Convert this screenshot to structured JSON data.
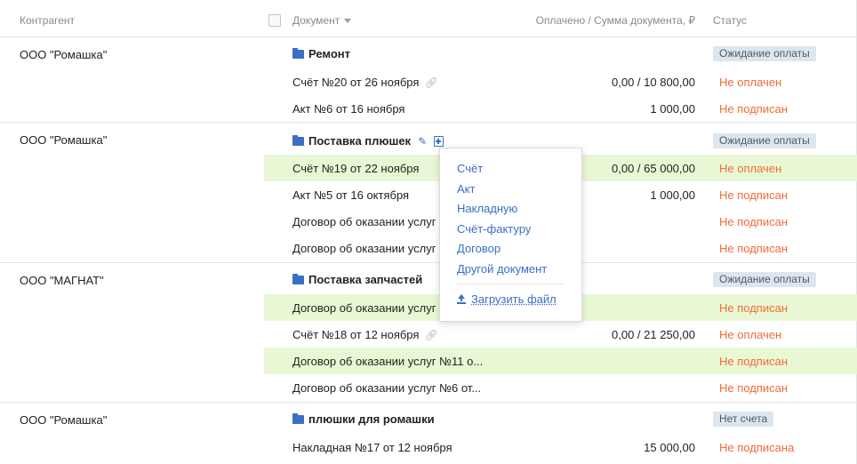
{
  "header": {
    "contractor": "Контрагент",
    "document": "Документ",
    "paid": "Оплачено / Сумма документа, ₽",
    "status": "Статус"
  },
  "groups": [
    {
      "contractor": "ООО \"Ромашка\"",
      "title": "Ремонт",
      "badge": "Ожидание оплаты",
      "rows": [
        {
          "doc": "Счёт №20 от 26 ноября",
          "amount": "0,00 / 10 800,00",
          "status": "Не оплачен"
        },
        {
          "doc": "Акт №6 от 16 ноября",
          "amount": "1 000,00",
          "status": "Не подписан"
        }
      ]
    },
    {
      "contractor": "ООО \"Ромашка\"",
      "title": "Поставка плюшек",
      "badge": "Ожидание оплаты",
      "rows": [
        {
          "doc": "Счёт №19 от 22 ноября",
          "amount": "0,00 / 65 000,00",
          "status": "Не оплачен"
        },
        {
          "doc": "Акт №5 от 16 октября",
          "amount": "1 000,00",
          "status": "Не подписан"
        },
        {
          "doc": "Договор об оказании услуг",
          "amount": "",
          "status": "Не подписан"
        },
        {
          "doc": "Договор об оказании услуг",
          "amount": "",
          "status": "Не подписан"
        }
      ]
    },
    {
      "contractor": "ООО \"МАГНАТ\"",
      "title": "Поставка запчастей",
      "badge": "Ожидание оплаты",
      "rows": [
        {
          "doc": "Договор об оказании услуг",
          "amount": "",
          "status": "Не подписан"
        },
        {
          "doc": "Счёт №18 от 12 ноября",
          "amount": "0,00 / 21 250,00",
          "status": "Не оплачен"
        },
        {
          "doc": "Договор об оказании услуг №11 о...",
          "amount": "",
          "status": "Не подписан"
        },
        {
          "doc": "Договор об оказании услуг №6 от...",
          "amount": "",
          "status": "Не подписан"
        }
      ]
    },
    {
      "contractor": "ООО \"Ромашка\"",
      "title": "плюшки для ромашки",
      "badge": "Нет счета",
      "rows": [
        {
          "doc": "Накладная №17 от 12 ноября",
          "amount": "15 000,00",
          "status": "Не подписана"
        }
      ]
    }
  ],
  "menu": {
    "items": [
      "Счёт",
      "Акт",
      "Накладную",
      "Счёт-фактуру",
      "Договор",
      "Другой документ"
    ],
    "upload": "Загрузить файл"
  },
  "colors": {
    "accent": "#3a6fc4",
    "status_negative": "#f26b3a",
    "highlight_row": "#e9f8d4",
    "badge_bg": "#dde6ef"
  }
}
